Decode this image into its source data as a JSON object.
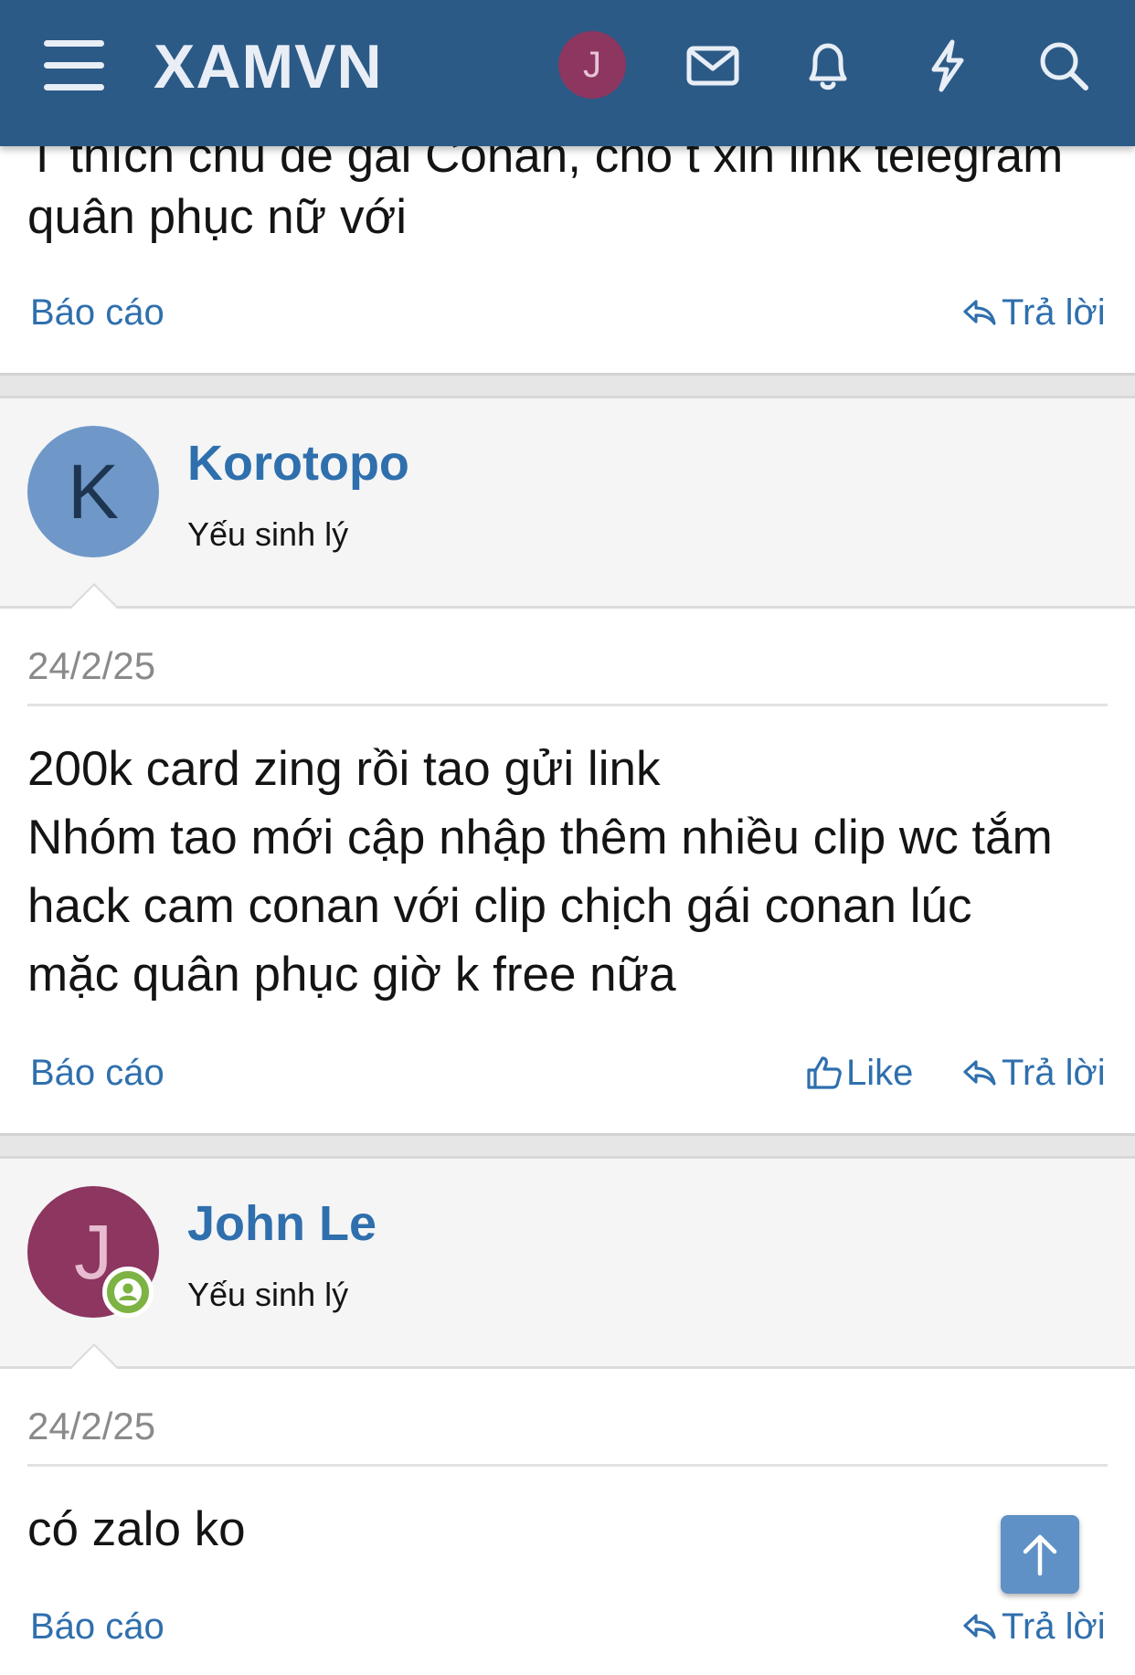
{
  "header": {
    "logo": "XAMVN",
    "user_initial": "J",
    "icons": [
      "menu-icon",
      "envelope-icon",
      "bell-icon",
      "lightning-icon",
      "search-icon"
    ]
  },
  "posts": [
    {
      "body_cut": "T thích chủ đề gái Conan, cho t xin link telegram",
      "body_line": "quân phục nữ với",
      "report_label": "Báo cáo",
      "reply_label": "Trả lời"
    },
    {
      "author": "Korotopo",
      "initial": "K",
      "user_title": "Yếu sinh lý",
      "date": "24/2/25",
      "body_lines": [
        "200k card zing rồi tao gửi link",
        "Nhóm tao mới cập nhập thêm nhiều clip wc tắm",
        "hack cam conan với clip chịch gái conan lúc",
        "mặc quân phục giờ k free nữa"
      ],
      "report_label": "Báo cáo",
      "like_label": "Like",
      "reply_label": "Trả lời",
      "avatar_color": "#6f98c9"
    },
    {
      "author": "John Le",
      "initial": "J",
      "user_title": "Yếu sinh lý",
      "date": "24/2/25",
      "body_lines": [
        "có zalo ko"
      ],
      "report_label": "Báo cáo",
      "reply_label": "Trả lời",
      "avatar_color": "#8c3660"
    }
  ],
  "colors": {
    "header_bg": "#2c5a86",
    "link": "#2f6fad",
    "online": "#7cb342"
  }
}
